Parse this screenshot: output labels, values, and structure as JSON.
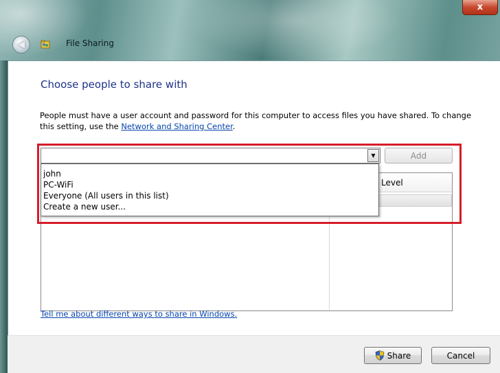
{
  "window": {
    "title": "File Sharing",
    "close_label": "x"
  },
  "main": {
    "heading": "Choose people to share with",
    "description_prefix": "People must have a user account and password for this computer to access files you have shared.  To change this setting, use the ",
    "description_link": "Network and Sharing Center",
    "description_suffix": "."
  },
  "combo": {
    "value": "",
    "add_label": "Add",
    "options": [
      "john",
      "PC-WiFi",
      "Everyone (All users in this list)",
      "Create a new user..."
    ]
  },
  "table": {
    "permission_header": "Level"
  },
  "help_link": "Tell me about different ways to share in Windows.",
  "footer": {
    "share_label": "Share",
    "cancel_label": "Cancel"
  },
  "colors": {
    "heading": "#1e3287",
    "link": "#0645ad",
    "highlight": "#d51b2a"
  }
}
